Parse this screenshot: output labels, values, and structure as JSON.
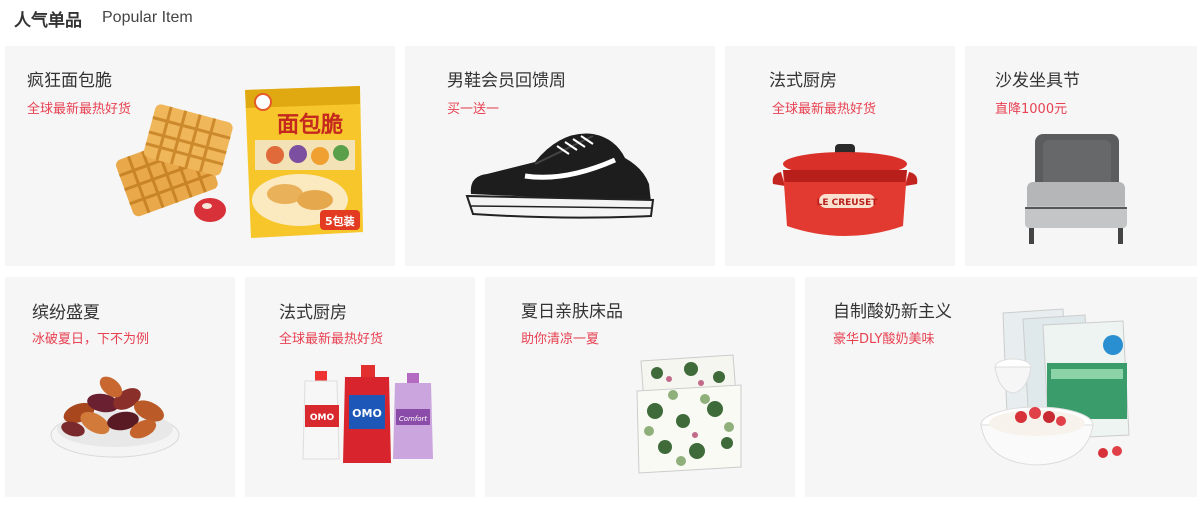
{
  "header": {
    "title_cn": "人气单品",
    "title_en": "Popular Item"
  },
  "cards": [
    {
      "name": "疯狂面包脆",
      "sub": "全球最新最热好货",
      "image": "waffle-snack-bag",
      "bag_text": "面包脆",
      "bag_badge": "5包装"
    },
    {
      "name": "男鞋会员回馈周",
      "sub": "买一送一",
      "image": "black-canvas-sneaker"
    },
    {
      "name": "法式厨房",
      "sub": "全球最新最热好货",
      "image": "red-cast-iron-pot",
      "brand": "LE CREUSET"
    },
    {
      "name": "沙发坐具节",
      "sub": "直降1000元",
      "image": "grey-lounge-chair"
    },
    {
      "name": "缤纷盛夏",
      "sub": "冰破夏日，下不为例",
      "image": "dried-fruit-bowl"
    },
    {
      "name": "法式厨房",
      "sub": "全球最新最热好货",
      "image": "laundry-detergent-bottles",
      "brand_omo": "OMO",
      "brand_comfort": "Comfort"
    },
    {
      "name": "夏日亲肤床品",
      "sub": "助你清凉一夏",
      "image": "floral-bedding-set"
    },
    {
      "name": "自制酸奶新主义",
      "sub": "豪华DLY酸奶美味",
      "image": "yogurt-starter-packs"
    }
  ],
  "colors": {
    "card_bg": "#f5f6f5",
    "accent_red": "#e84152",
    "title": "#333333"
  }
}
